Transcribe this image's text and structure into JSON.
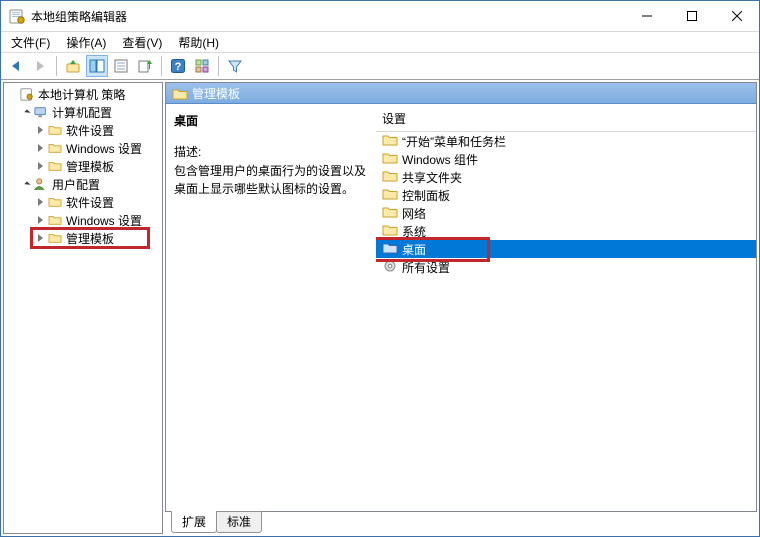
{
  "title": "本地组策略编辑器",
  "menu": {
    "file": "文件(F)",
    "action": "操作(A)",
    "view": "查看(V)",
    "help": "帮助(H)"
  },
  "tree": {
    "root": "本地计算机 策略",
    "computer": "计算机配置",
    "computer_children": [
      "软件设置",
      "Windows 设置",
      "管理模板"
    ],
    "user": "用户配置",
    "user_children": [
      "软件设置",
      "Windows 设置",
      "管理模板"
    ]
  },
  "pathbar": "管理模板",
  "details": {
    "heading": "桌面",
    "desc_label": "描述:",
    "desc_text": "包含管理用户的桌面行为的设置以及桌面上显示哪些默认图标的设置。"
  },
  "list": {
    "header": "设置",
    "items": [
      "“开始”菜单和任务栏",
      "Windows 组件",
      "共享文件夹",
      "控制面板",
      "网络",
      "系统",
      "桌面",
      "所有设置"
    ],
    "selected_index": 6,
    "special_icon_index": 7
  },
  "tabs": {
    "extended": "扩展",
    "standard": "标准"
  }
}
